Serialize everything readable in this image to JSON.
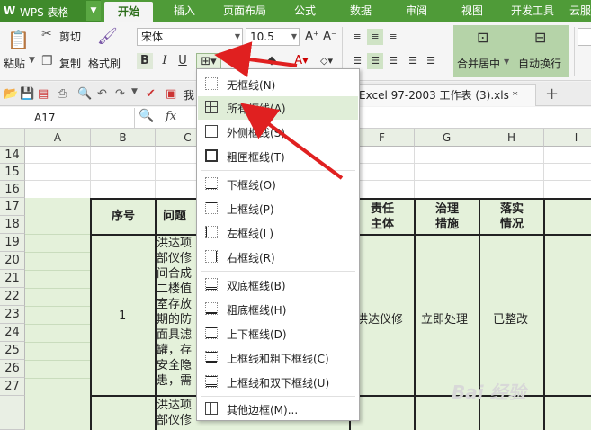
{
  "app": {
    "name": "WPS 表格",
    "logo": "W"
  },
  "ribbon_tabs": [
    "开始",
    "插入",
    "页面布局",
    "公式",
    "数据",
    "审阅",
    "视图",
    "开发工具",
    "云服"
  ],
  "active_tab": "开始",
  "clipboard": {
    "paste": "粘贴",
    "cut": "剪切",
    "copy": "复制",
    "format_painter": "格式刷"
  },
  "font": {
    "name": "宋体",
    "size": "10.5",
    "bold": "B",
    "italic": "I",
    "underline": "U",
    "grow": "A⁺",
    "shrink": "A⁻"
  },
  "alignment": {
    "merge_center": "合并居中",
    "wrap_text": "自动换行"
  },
  "quick_access_partial": "我",
  "document_tab": "Excel 97-2003 工作表 (3).xls *",
  "name_box": "A17",
  "fx_label": "fx",
  "columns": [
    "A",
    "B",
    "C",
    "D",
    "E",
    "F",
    "G",
    "H",
    "I"
  ],
  "rows": [
    "14",
    "15",
    "16",
    "17",
    "18",
    "19",
    "20",
    "21",
    "22",
    "23",
    "24",
    "25",
    "26",
    "27"
  ],
  "table": {
    "headers": {
      "number": "序号",
      "problem": "问题",
      "responsible": [
        "责任",
        "主体"
      ],
      "governance": [
        "治理",
        "措施"
      ],
      "implementation": [
        "落实",
        "情况"
      ]
    },
    "row1": {
      "number": "1",
      "problem_lines": [
        "洪达项",
        "部仪修",
        "间合成",
        "二楼值",
        "室存放",
        "期的防",
        "面具滤",
        "罐，存",
        "安全隐",
        "患，需"
      ],
      "responsible": "洪达仪修",
      "governance": "立即处理",
      "implementation": "已整改"
    },
    "row2_problem_lines": [
      "洪达项",
      "部仪修"
    ]
  },
  "border_menu": {
    "items": [
      {
        "label": "无框线(N)",
        "highlighted": false
      },
      {
        "label": "所有框线(A)",
        "highlighted": true
      },
      {
        "label": "外侧框线(S)",
        "highlighted": false
      },
      {
        "label": "粗匣框线(T)",
        "highlighted": false
      },
      {
        "label": "下框线(O)",
        "highlighted": false
      },
      {
        "label": "上框线(P)",
        "highlighted": false
      },
      {
        "label": "左框线(L)",
        "highlighted": false
      },
      {
        "label": "右框线(R)",
        "highlighted": false
      },
      {
        "label": "双底框线(B)",
        "highlighted": false
      },
      {
        "label": "粗底框线(H)",
        "highlighted": false
      },
      {
        "label": "上下框线(D)",
        "highlighted": false
      },
      {
        "label": "上框线和粗下框线(C)",
        "highlighted": false
      },
      {
        "label": "上框线和双下框线(U)",
        "highlighted": false
      },
      {
        "label": "其他边框(M)...",
        "highlighted": false
      }
    ]
  },
  "watermark": "Bai 经验",
  "colors": {
    "ribbon_green": "#4f9b38",
    "highlight": "#e0eed8",
    "annotation_red": "#e02020",
    "sheet_green": "#e4f1da"
  }
}
